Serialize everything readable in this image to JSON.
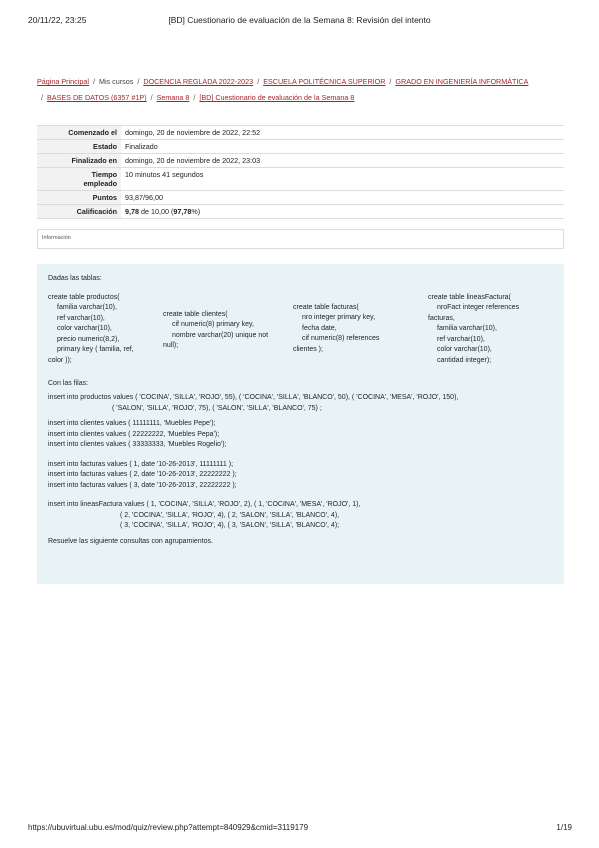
{
  "header": {
    "datetime": "20/11/22, 23:25",
    "title": "[BD] Cuestionario de evaluación de la Semana 8: Revisión del intento"
  },
  "breadcrumb": [
    {
      "label": "Página Principal",
      "link": true
    },
    {
      "label": "Mis cursos",
      "link": false
    },
    {
      "label": "DOCENCIA REGLADA 2022-2023",
      "link": true
    },
    {
      "label": "ESCUELA POLITÉCNICA SUPERIOR",
      "link": true
    },
    {
      "label": "GRADO EN INGENIERÍA INFORMÁTICA",
      "link": true
    },
    {
      "label": "BASES DE DATOS (6357 #1P)",
      "link": true
    },
    {
      "label": "Semana 8",
      "link": true
    },
    {
      "label": "[BD] Cuestionario de evaluación de la Semana 8",
      "link": true
    }
  ],
  "summary": {
    "started_label": "Comenzado el",
    "started_value": "domingo, 20 de noviembre de 2022, 22:52",
    "state_label": "Estado",
    "state_value": "Finalizado",
    "finished_label": "Finalizado en",
    "finished_value": "domingo, 20 de noviembre de 2022, 23:03",
    "time_label_1": "Tiempo",
    "time_label_2": "empleado",
    "time_value": "10 minutos 41 segundos",
    "points_label": "Puntos",
    "points_value": "93,87/96,00",
    "grade_label": "Calificación",
    "grade_score": "9,78",
    "grade_mid": " de 10,00 (",
    "grade_pct": "97,78",
    "grade_end": "%)"
  },
  "info_label": "Información",
  "question": {
    "intro": "Dadas las tablas:",
    "productos": [
      "create table productos(",
      "familia varchar(10),",
      "ref    varchar(10),",
      "color   varchar(10),",
      "precio  numeric(8,2),",
      "primary key ( familia, ref,",
      "color ));"
    ],
    "clientes": [
      "create table clientes(",
      "cif    numeric(8)   primary key,",
      "nombre  varchar(20)  unique not",
      "null);"
    ],
    "facturas": [
      "create table facturas(",
      "nro     integer      primary key,",
      "fecha  date,",
      "cif     numeric(8) references",
      "clientes    );"
    ],
    "lineas": [
      "create table lineasFactura(",
      "nroFact  integer references",
      "facturas,",
      "familia  varchar(10),",
      "ref       varchar(10),",
      "color     varchar(10),",
      "cantidad integer);"
    ],
    "rows_intro": "Con las filas:",
    "ins_productos_1": "insert into productos values ( 'COCINA', 'SILLA', 'ROJO', 55), ( 'COCINA', 'SILLA', 'BLANCO', 50), ( 'COCINA', 'MESA', 'ROJO', 150),",
    "ins_productos_2": "( 'SALON', 'SILLA', 'ROJO', 75), ( 'SALON', 'SILLA', 'BLANCO', 75) ;",
    "ins_clientes": [
      "insert into clientes values ( 11111111, 'Muebles Pepe');",
      "insert into clientes values ( 22222222, 'Muebles Pepa');",
      "insert into clientes values ( 33333333, 'Muebles Rogelio');"
    ],
    "ins_facturas": [
      "insert into facturas values ( 1, date '10-26-2013', 11111111 );",
      "insert into facturas values ( 2, date '10-26-2013', 22222222 );",
      "insert into facturas values ( 3, date '10-26-2013', 22222222 );"
    ],
    "ins_lineas_1": "insert into lineasFactura values ( 1, 'COCINA', 'SILLA', 'ROJO', 2), ( 1, 'COCINA', 'MESA', 'ROJO', 1),",
    "ins_lineas_2": "( 2, 'COCINA', 'SILLA', 'ROJO', 4), ( 2, 'SALON', 'SILLA', 'BLANCO', 4),",
    "ins_lineas_3": "( 3, 'COCINA', 'SILLA', 'ROJO', 4), ( 3, 'SALON', 'SILLA', 'BLANCO', 4);",
    "outro": "Resuelve las siguiente consultas con agrupamientos."
  },
  "footer": {
    "url": "https://ubuvirtual.ubu.es/mod/quiz/review.php?attempt=840929&cmid=3119179",
    "page": "1/19"
  },
  "colors": {
    "link": "#a4262c",
    "question_bg": "#e7f3f5",
    "label_bg": "#f2f2f2"
  }
}
